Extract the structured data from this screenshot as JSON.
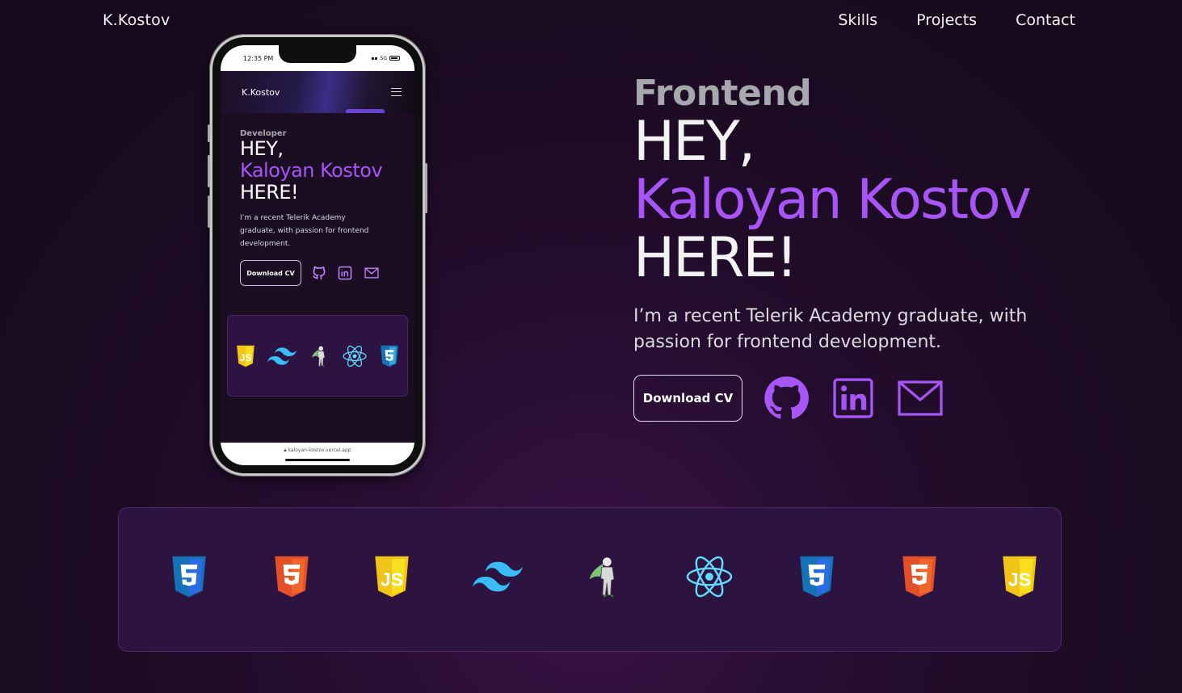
{
  "nav": {
    "brand": "K.Kostov",
    "links": [
      "Skills",
      "Projects",
      "Contact"
    ]
  },
  "hero": {
    "subtitle": "Frontend",
    "greeting": "HEY,",
    "name": "Kaloyan Kostov",
    "here": "HERE!",
    "description": "I’m a recent Telerik Academy graduate, with passion for frontend development.",
    "cv_label": "Download CV",
    "socials": [
      "github-icon",
      "linkedin-icon",
      "mail-icon"
    ]
  },
  "phone": {
    "time": "12:35 PM",
    "network": "5G",
    "brand": "K.Kostov",
    "subtitle": "Developer",
    "greeting": "HEY,",
    "name": "Kaloyan Kostov",
    "here": "HERE!",
    "description": "I’m a recent Telerik Academy graduate, with passion for frontend development.",
    "cv_label": "Download CV",
    "url": "kaloyan-kostov.vercel.app",
    "tech": [
      "js-icon",
      "tailwind-icon",
      "supabase-hero-icon",
      "react-icon",
      "css3-icon"
    ]
  },
  "tech_strip": [
    "css3-icon",
    "html5-icon",
    "js-icon",
    "tailwind-icon",
    "supabase-hero-icon",
    "react-icon",
    "css3-icon",
    "html5-icon",
    "js-icon"
  ],
  "colors": {
    "accent": "#a855f7",
    "background": "#1a0b20",
    "strip": "#2c1340"
  }
}
